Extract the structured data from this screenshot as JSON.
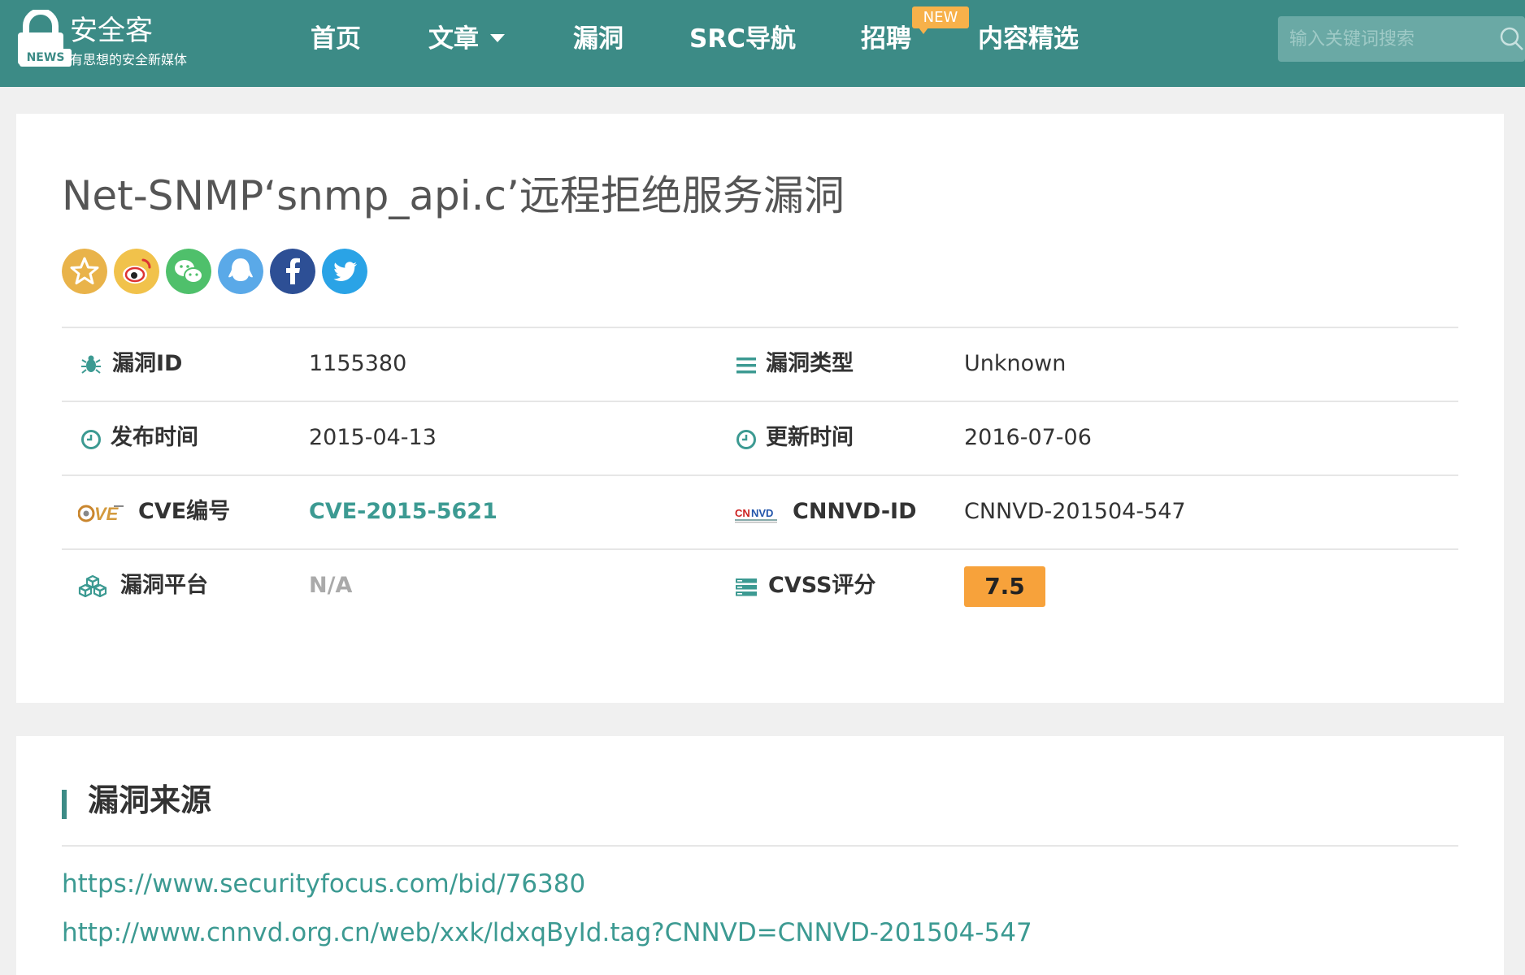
{
  "header": {
    "brand_title": "安全客",
    "brand_subtitle": "有思想的安全新媒体",
    "brand_badge": "NEWS",
    "nav": [
      {
        "label": "首页"
      },
      {
        "label": "文章"
      },
      {
        "label": "漏洞"
      },
      {
        "label": "SRC导航"
      },
      {
        "label": "招聘"
      },
      {
        "label": "内容精选"
      }
    ],
    "new_badge": "NEW",
    "search_placeholder": "输入关键词搜索"
  },
  "article": {
    "title": "Net-SNMP‘snmp_api.c’远程拒绝服务漏洞",
    "share_icons": [
      "favorite-icon",
      "weibo-icon",
      "wechat-icon",
      "qq-icon",
      "facebook-icon",
      "twitter-icon"
    ]
  },
  "details": {
    "vuln_id_label": "漏洞ID",
    "vuln_id": "1155380",
    "vuln_type_label": "漏洞类型",
    "vuln_type": "Unknown",
    "publish_label": "发布时间",
    "publish_date": "2015-04-13",
    "update_label": "更新时间",
    "update_date": "2016-07-06",
    "cve_label": "CVE编号",
    "cve_id": "CVE-2015-5621",
    "cnnvd_label": "CNNVD-ID",
    "cnnvd_id": "CNNVD-201504-547",
    "platform_label": "漏洞平台",
    "platform": "N/A",
    "cvss_label": "CVSS评分",
    "cvss_score": "7.5"
  },
  "sources": {
    "heading": "漏洞来源",
    "links": [
      "https://www.securityfocus.com/bid/76380",
      "http://www.cnnvd.org.cn/web/xxk/ldxqById.tag?CNNVD=CNNVD-201504-547"
    ]
  },
  "colors": {
    "header_bg": "#3c8b86",
    "accent": "#3c9a92",
    "score_bg": "#f7a23b",
    "new_badge_bg": "#f7b14a"
  }
}
